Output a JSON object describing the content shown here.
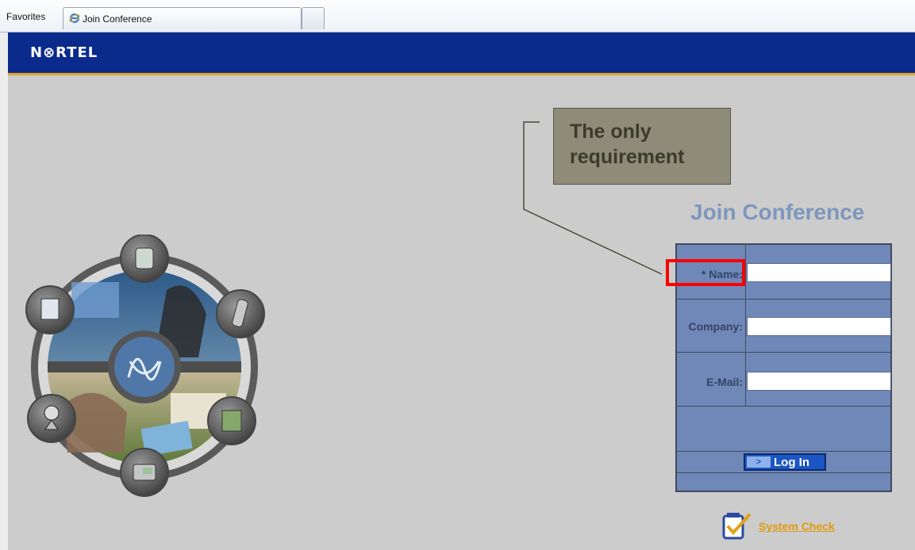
{
  "browser": {
    "favorites_label": "Favorites",
    "tab_title": "Join Conference"
  },
  "header": {
    "logo_text": "N⊗RTEL"
  },
  "annotation": {
    "callout_text": "The only requirement"
  },
  "form": {
    "title": "Join Conference",
    "fields": [
      {
        "label": "* Name:",
        "value": ""
      },
      {
        "label": "Company:",
        "value": ""
      },
      {
        "label": "E-Mail:",
        "value": ""
      }
    ],
    "login_label": "Log In",
    "login_arrow": ">"
  },
  "system_check": {
    "label": "System Check"
  },
  "colors": {
    "header_blue": "#0a2a8c",
    "header_accent": "#e5a224",
    "form_panel": "#7088b8",
    "title_text": "#7d97bd",
    "highlight": "#ff0000",
    "callout_box": "#8e8c78",
    "link": "#e09a10"
  }
}
